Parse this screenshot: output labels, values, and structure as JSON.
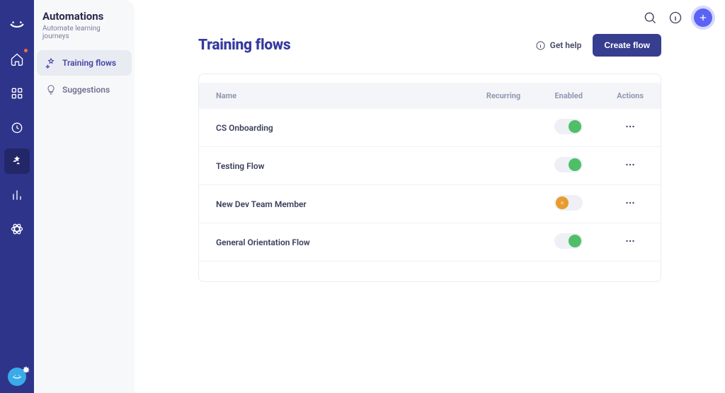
{
  "sidebar": {
    "title": "Automations",
    "subtitle": "Automate learning journeys",
    "items": [
      {
        "label": "Training flows",
        "active": true
      },
      {
        "label": "Suggestions",
        "active": false
      }
    ]
  },
  "page": {
    "title": "Training flows",
    "get_help_label": "Get help",
    "create_label": "Create flow"
  },
  "table": {
    "columns": {
      "name": "Name",
      "recurring": "Recurring",
      "enabled": "Enabled",
      "actions": "Actions"
    },
    "rows": [
      {
        "name": "CS Onboarding",
        "recurring": "",
        "enabled": true
      },
      {
        "name": "Testing Flow",
        "recurring": "",
        "enabled": true
      },
      {
        "name": "New Dev Team Member",
        "recurring": "",
        "enabled": false
      },
      {
        "name": "General Orientation Flow",
        "recurring": "",
        "enabled": true
      }
    ]
  },
  "colors": {
    "brand_dark": "#2f348b",
    "accent": "#5b63f5",
    "toggle_on": "#4fbf67",
    "toggle_off": "#e89b2e"
  }
}
